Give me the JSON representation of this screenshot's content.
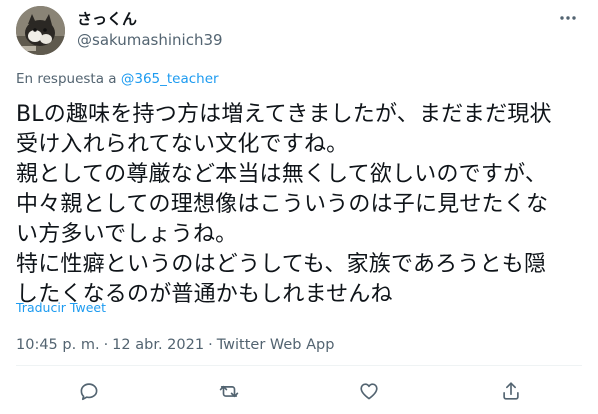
{
  "author": {
    "display_name": "さっくん",
    "handle": "@sakumashinich39"
  },
  "reply": {
    "prefix": "En respuesta a",
    "mention": "@365_teacher"
  },
  "tweet": {
    "text": "BLの趣味を持つ方は増えてきましたが、まだまだ現状\n受け入れられてない文化ですね。\n親としての尊厳など本当は無くして欲しいのですが、\n中々親としての理想像はこういうのは子に見せたくな\nい方多いでしょうね。\n特に性癖というのはどうしても、家族であろうとも隠\nしたくなるのが普通かもしれませんね"
  },
  "translate_label": "Traducir Tweet",
  "meta": {
    "time": "10:45 p. m.",
    "separator_1": "·",
    "date": "12 abr. 2021",
    "separator_2": "·",
    "source": "Twitter Web App"
  },
  "icons": {
    "more": "more-icon",
    "reply": "reply-icon",
    "retweet": "retweet-icon",
    "like": "like-icon",
    "share": "share-icon"
  },
  "colors": {
    "text": "#0f1419",
    "secondary": "#536471",
    "accent": "#1d9bf0",
    "divider": "#eff3f4"
  }
}
